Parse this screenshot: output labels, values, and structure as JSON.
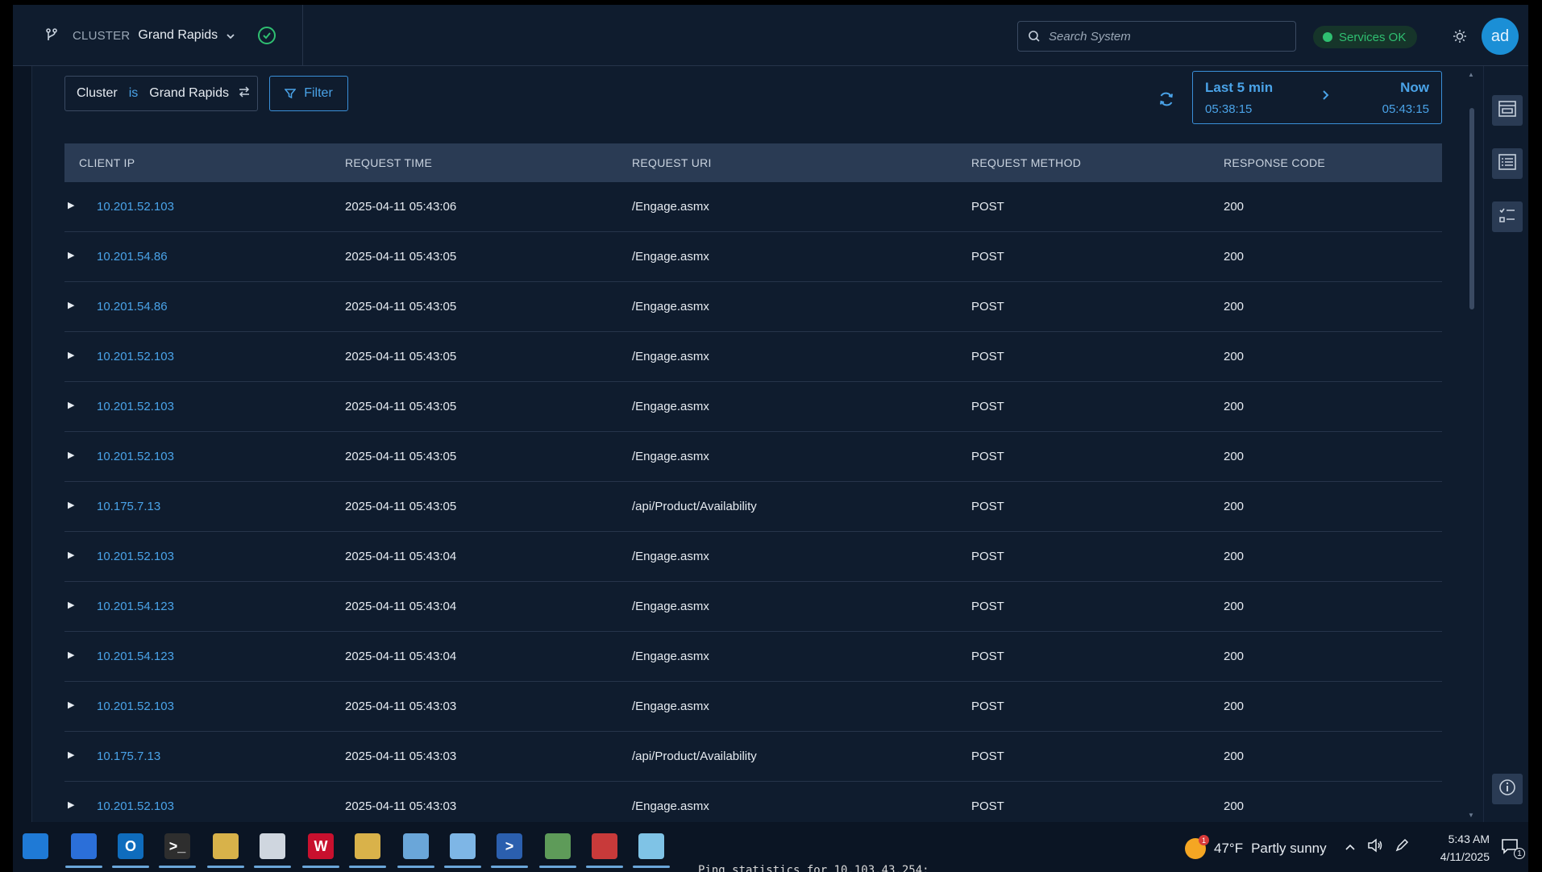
{
  "header": {
    "cluster_label": "CLUSTER",
    "cluster_name": "Grand Rapids",
    "search_placeholder": "Search System",
    "services_status": "Services OK",
    "avatar_initials": "ad"
  },
  "filter": {
    "field": "Cluster",
    "operator": "is",
    "value": "Grand Rapids",
    "button_label": "Filter"
  },
  "time_range": {
    "start_label": "Last 5 min",
    "start_time": "05:38:15",
    "end_label": "Now",
    "end_time": "05:43:15"
  },
  "table": {
    "columns": [
      "CLIENT IP",
      "REQUEST TIME",
      "REQUEST URI",
      "REQUEST METHOD",
      "RESPONSE CODE"
    ],
    "rows": [
      {
        "ip": "10.201.52.103",
        "time": "2025-04-11 05:43:06",
        "uri": "/Engage.asmx",
        "method": "POST",
        "code": "200"
      },
      {
        "ip": "10.201.54.86",
        "time": "2025-04-11 05:43:05",
        "uri": "/Engage.asmx",
        "method": "POST",
        "code": "200"
      },
      {
        "ip": "10.201.54.86",
        "time": "2025-04-11 05:43:05",
        "uri": "/Engage.asmx",
        "method": "POST",
        "code": "200"
      },
      {
        "ip": "10.201.52.103",
        "time": "2025-04-11 05:43:05",
        "uri": "/Engage.asmx",
        "method": "POST",
        "code": "200"
      },
      {
        "ip": "10.201.52.103",
        "time": "2025-04-11 05:43:05",
        "uri": "/Engage.asmx",
        "method": "POST",
        "code": "200"
      },
      {
        "ip": "10.201.52.103",
        "time": "2025-04-11 05:43:05",
        "uri": "/Engage.asmx",
        "method": "POST",
        "code": "200"
      },
      {
        "ip": "10.175.7.13",
        "time": "2025-04-11 05:43:05",
        "uri": "/api/Product/Availability",
        "method": "POST",
        "code": "200"
      },
      {
        "ip": "10.201.52.103",
        "time": "2025-04-11 05:43:04",
        "uri": "/Engage.asmx",
        "method": "POST",
        "code": "200"
      },
      {
        "ip": "10.201.54.123",
        "time": "2025-04-11 05:43:04",
        "uri": "/Engage.asmx",
        "method": "POST",
        "code": "200"
      },
      {
        "ip": "10.201.54.123",
        "time": "2025-04-11 05:43:04",
        "uri": "/Engage.asmx",
        "method": "POST",
        "code": "200"
      },
      {
        "ip": "10.201.52.103",
        "time": "2025-04-11 05:43:03",
        "uri": "/Engage.asmx",
        "method": "POST",
        "code": "200"
      },
      {
        "ip": "10.175.7.13",
        "time": "2025-04-11 05:43:03",
        "uri": "/api/Product/Availability",
        "method": "POST",
        "code": "200"
      },
      {
        "ip": "10.201.52.103",
        "time": "2025-04-11 05:43:03",
        "uri": "/Engage.asmx",
        "method": "POST",
        "code": "200"
      }
    ]
  },
  "taskbar": {
    "icons": [
      {
        "name": "edge-icon",
        "glyph": "",
        "color": "#1f7ad6"
      },
      {
        "name": "store-icon",
        "glyph": "",
        "color": "#2b6fd9"
      },
      {
        "name": "outlook-icon",
        "glyph": "O",
        "color": "#0f6cbd"
      },
      {
        "name": "terminal-icon",
        "glyph": ">_",
        "color": "#2e2e2e"
      },
      {
        "name": "folder-stack-icon",
        "glyph": "",
        "color": "#d8b24a"
      },
      {
        "name": "notepad-icon",
        "glyph": "",
        "color": "#cfd6df"
      },
      {
        "name": "word-w-icon",
        "glyph": "W",
        "color": "#c8102e"
      },
      {
        "name": "certificate-icon",
        "glyph": "",
        "color": "#d9b24a"
      },
      {
        "name": "network-tool-icon",
        "glyph": "",
        "color": "#6aa6d9"
      },
      {
        "name": "remote-desktop-icon",
        "glyph": "",
        "color": "#7eb6e6"
      },
      {
        "name": "powershell-icon",
        "glyph": ">",
        "color": "#2b5fae"
      },
      {
        "name": "services-tool-icon",
        "glyph": "",
        "color": "#5e9b59"
      },
      {
        "name": "toolbox-icon",
        "glyph": "",
        "color": "#c83a3a"
      },
      {
        "name": "app-icon",
        "glyph": "",
        "color": "#7fc3e6"
      }
    ],
    "weather_temp": "47°F",
    "weather_desc": "Partly sunny",
    "weather_badge": "1",
    "clock_time": "5:43 AM",
    "clock_date": "4/11/2025",
    "notification_count": "1"
  },
  "console_peek": "Ping statistics for 10.103.43.254:",
  "colors": {
    "accent": "#4aa3e8",
    "success": "#2fbf71",
    "background": "#0f1c2e",
    "table_header": "#2a3b54"
  }
}
